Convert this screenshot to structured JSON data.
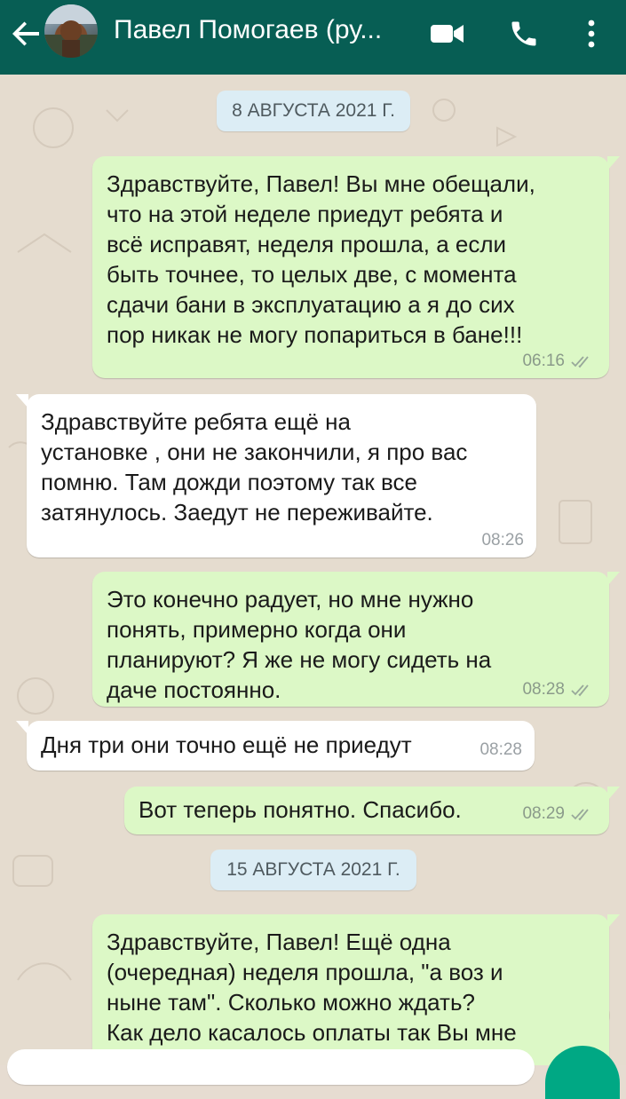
{
  "header": {
    "contact_name": "Павел Помогаев (ру...",
    "icons": [
      "back-arrow-icon",
      "avatar",
      "video-call-icon",
      "phone-icon",
      "more-vert-icon"
    ],
    "colors": {
      "bar": "#075e54",
      "outgoing": "#dcf8c6",
      "incoming": "#ffffff",
      "date_chip": "#dcedf5",
      "send_button": "#00a884"
    }
  },
  "chat": {
    "date_1": "8 АВГУСТА 2021 Г.",
    "date_2": "15 АВГУСТА 2021 Г.",
    "messages": [
      {
        "direction": "out",
        "text": "Здравствуйте, Павел! Вы мне обещали,\nчто на этой неделе приедут ребята и\nвсё исправят, неделя прошла, а если\nбыть точнее, то целых две, с момента\nсдачи бани в эксплуатацию а я до сих\nпор никак не могу попариться в бане!!!",
        "time": "06:16",
        "status": "read"
      },
      {
        "direction": "in",
        "text": "Здравствуйте ребята ещё на\nустановке , они не закончили, я про вас\nпомню. Там дожди поэтому так все\nзатянулось. Заедут не переживайте.",
        "time": "08:26"
      },
      {
        "direction": "out",
        "text": "Это конечно радует, но мне нужно\nпонять, примерно когда они\nпланируют? Я же не могу сидеть на\nдаче постоянно.",
        "time": "08:28",
        "status": "read"
      },
      {
        "direction": "in",
        "text": "Дня три они точно ещё не приедут",
        "time": "08:28"
      },
      {
        "direction": "out",
        "text": "Вот теперь понятно. Спасибо.",
        "time": "08:29",
        "status": "read"
      },
      {
        "direction": "out",
        "text": "Здравствуйте, Павел! Ещё одна\n(очередная) неделя прошла, \"а воз и\nныне там\". Сколько можно ждать?\nКак дело касалось оплаты так Вы мне",
        "time": "",
        "status": ""
      }
    ]
  }
}
